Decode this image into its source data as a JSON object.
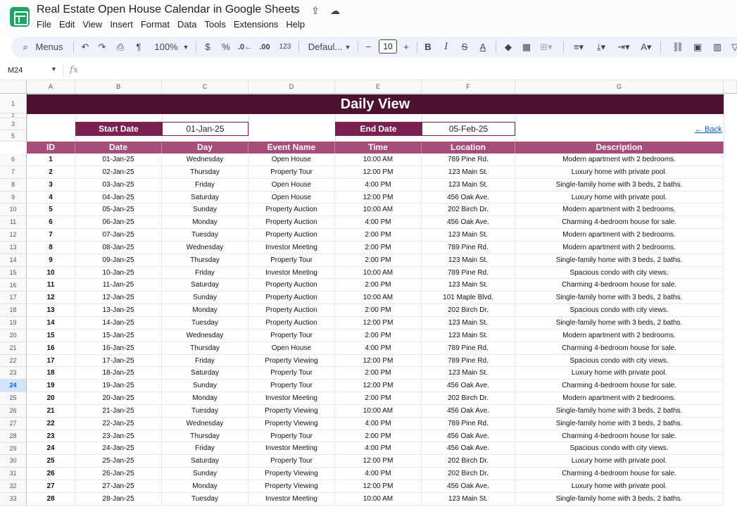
{
  "app": {
    "doc_title": "Real Estate Open House Calendar in Google Sheets",
    "menus": [
      "File",
      "Edit",
      "View",
      "Insert",
      "Format",
      "Data",
      "Tools",
      "Extensions",
      "Help"
    ],
    "title_icons": [
      "star-icon",
      "move-to-folder-icon",
      "cloud-status-icon"
    ]
  },
  "toolbar": {
    "search_label": "Menus",
    "zoom": "100%",
    "currency": "$",
    "percent": "%",
    "dec_decrease": ".0←",
    "dec_increase": ".00",
    "number_format": "123",
    "font": "Defaul...",
    "font_size": "10"
  },
  "formula_bar": {
    "cell_ref": "M24",
    "fx": "fx"
  },
  "columns": [
    "A",
    "B",
    "C",
    "D",
    "E",
    "F",
    "G"
  ],
  "row_numbers": [
    "1",
    "2",
    "3",
    "5",
    "6",
    "7",
    "8",
    "9",
    "10",
    "11",
    "12",
    "13",
    "14",
    "15",
    "16",
    "17",
    "18",
    "19",
    "20",
    "21",
    "22",
    "23",
    "24",
    "25",
    "26",
    "27",
    "28",
    "29",
    "30",
    "31",
    "32",
    "33"
  ],
  "selected_row": "24",
  "sheet": {
    "banner": "Daily View",
    "start_label": "Start Date",
    "start_value": "01-Jan-25",
    "end_label": "End Date",
    "end_value": "05-Feb-25",
    "back_link": "← Back",
    "headers": [
      "ID",
      "Date",
      "Day",
      "Event Name",
      "Time",
      "Location",
      "Description"
    ],
    "rows": [
      [
        "1",
        "01-Jan-25",
        "Wednesday",
        "Open House",
        "10:00 AM",
        "789 Pine Rd.",
        "Modern apartment with 2 bedrooms."
      ],
      [
        "2",
        "02-Jan-25",
        "Thursday",
        "Property Tour",
        "12:00 PM",
        "123 Main St.",
        "Luxury home with private pool."
      ],
      [
        "3",
        "03-Jan-25",
        "Friday",
        "Open House",
        "4:00 PM",
        "123 Main St.",
        "Single-family home with 3 beds, 2 baths."
      ],
      [
        "4",
        "04-Jan-25",
        "Saturday",
        "Open House",
        "12:00 PM",
        "456 Oak Ave.",
        "Luxury home with private pool."
      ],
      [
        "5",
        "05-Jan-25",
        "Sunday",
        "Property Auction",
        "10:00 AM",
        "202 Birch Dr.",
        "Modern apartment with 2 bedrooms."
      ],
      [
        "6",
        "06-Jan-25",
        "Monday",
        "Property Auction",
        "4:00 PM",
        "456 Oak Ave.",
        "Charming 4-bedroom house for sale."
      ],
      [
        "7",
        "07-Jan-25",
        "Tuesday",
        "Property Auction",
        "2:00 PM",
        "123 Main St.",
        "Modern apartment with 2 bedrooms."
      ],
      [
        "8",
        "08-Jan-25",
        "Wednesday",
        "Investor Meeting",
        "2:00 PM",
        "789 Pine Rd.",
        "Modern apartment with 2 bedrooms."
      ],
      [
        "9",
        "09-Jan-25",
        "Thursday",
        "Property Tour",
        "2:00 PM",
        "123 Main St.",
        "Single-family home with 3 beds, 2 baths."
      ],
      [
        "10",
        "10-Jan-25",
        "Friday",
        "Investor Meeting",
        "10:00 AM",
        "789 Pine Rd.",
        "Spacious condo with city views."
      ],
      [
        "11",
        "11-Jan-25",
        "Saturday",
        "Property Auction",
        "2:00 PM",
        "123 Main St.",
        "Charming 4-bedroom house for sale."
      ],
      [
        "12",
        "12-Jan-25",
        "Sunday",
        "Property Auction",
        "10:00 AM",
        "101 Maple Blvd.",
        "Single-family home with 3 beds, 2 baths."
      ],
      [
        "13",
        "13-Jan-25",
        "Monday",
        "Property Auction",
        "2:00 PM",
        "202 Birch Dr.",
        "Spacious condo with city views."
      ],
      [
        "14",
        "14-Jan-25",
        "Tuesday",
        "Property Auction",
        "12:00 PM",
        "123 Main St.",
        "Single-family home with 3 beds, 2 baths."
      ],
      [
        "15",
        "15-Jan-25",
        "Wednesday",
        "Property Tour",
        "2:00 PM",
        "123 Main St.",
        "Modern apartment with 2 bedrooms."
      ],
      [
        "16",
        "16-Jan-25",
        "Thursday",
        "Open House",
        "4:00 PM",
        "789 Pine Rd.",
        "Charming 4-bedroom house for sale."
      ],
      [
        "17",
        "17-Jan-25",
        "Friday",
        "Property Viewing",
        "12:00 PM",
        "789 Pine Rd.",
        "Spacious condo with city views."
      ],
      [
        "18",
        "18-Jan-25",
        "Saturday",
        "Property Tour",
        "2:00 PM",
        "123 Main St.",
        "Luxury home with private pool."
      ],
      [
        "19",
        "19-Jan-25",
        "Sunday",
        "Property Tour",
        "12:00 PM",
        "456 Oak Ave.",
        "Charming 4-bedroom house for sale."
      ],
      [
        "20",
        "20-Jan-25",
        "Monday",
        "Investor Meeting",
        "2:00 PM",
        "202 Birch Dr.",
        "Modern apartment with 2 bedrooms."
      ],
      [
        "21",
        "21-Jan-25",
        "Tuesday",
        "Property Viewing",
        "10:00 AM",
        "456 Oak Ave.",
        "Single-family home with 3 beds, 2 baths."
      ],
      [
        "22",
        "22-Jan-25",
        "Wednesday",
        "Property Viewing",
        "4:00 PM",
        "789 Pine Rd.",
        "Single-family home with 3 beds, 2 baths."
      ],
      [
        "23",
        "23-Jan-25",
        "Thursday",
        "Property Tour",
        "2:00 PM",
        "456 Oak Ave.",
        "Charming 4-bedroom house for sale."
      ],
      [
        "24",
        "24-Jan-25",
        "Friday",
        "Investor Meeting",
        "4:00 PM",
        "456 Oak Ave.",
        "Spacious condo with city views."
      ],
      [
        "25",
        "25-Jan-25",
        "Saturday",
        "Property Tour",
        "12:00 PM",
        "202 Birch Dr.",
        "Luxury home with private pool."
      ],
      [
        "26",
        "26-Jan-25",
        "Sunday",
        "Property Viewing",
        "4:00 PM",
        "202 Birch Dr.",
        "Charming 4-bedroom house for sale."
      ],
      [
        "27",
        "27-Jan-25",
        "Monday",
        "Property Viewing",
        "12:00 PM",
        "456 Oak Ave.",
        "Luxury home with private pool."
      ],
      [
        "28",
        "28-Jan-25",
        "Tuesday",
        "Investor Meeting",
        "10:00 AM",
        "123 Main St.",
        "Single-family home with 3 beds, 2 baths."
      ]
    ]
  },
  "colors": {
    "banner": "#4d1232",
    "label_box": "#7b2151",
    "header_row": "#a64d79",
    "link": "#1155cc",
    "sheets_green": "#1fa463"
  }
}
